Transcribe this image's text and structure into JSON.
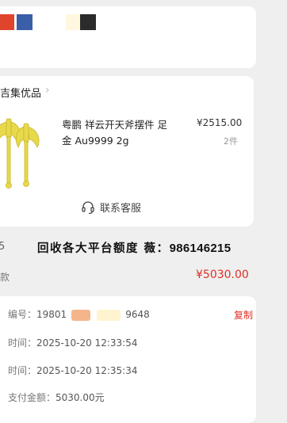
{
  "swatches": [
    {
      "name": "red-swatch",
      "color": "#e0442a"
    },
    {
      "name": "blue-swatch",
      "color": "#3a5ea8"
    },
    {
      "name": "cream-swatch",
      "color": "#fff8de"
    },
    {
      "name": "dark-swatch",
      "color": "#2b2b2b"
    }
  ],
  "shop": {
    "name": "吉集优品",
    "arrow": "›"
  },
  "product": {
    "title": "粤鹏 祥云开天斧摆件 足金 Au9999 2g",
    "price": "¥2515.00",
    "quantity": "2件",
    "image_icon": "golden-axe-ornament"
  },
  "service": {
    "icon": "headset-icon",
    "label": "联系客服"
  },
  "banner": {
    "text": "回收各大平台额度 薇：",
    "number": "986146215",
    "left_mark": "5"
  },
  "payment": {
    "label": "款",
    "amount": "¥5030.00"
  },
  "order": {
    "number_label": "编号：",
    "number_start": "19801",
    "number_end": "9648",
    "copy_label": "复制",
    "created_label": "时间：",
    "created_value": "2025-10-20 12:33:54",
    "paid_label": "时间：",
    "paid_value": "2025-10-20 12:35:34",
    "total_label": "支付金额：",
    "total_value": "5030.00元"
  },
  "colors": {
    "accent_red": "#e02e24",
    "gold": "#e8d94c"
  }
}
